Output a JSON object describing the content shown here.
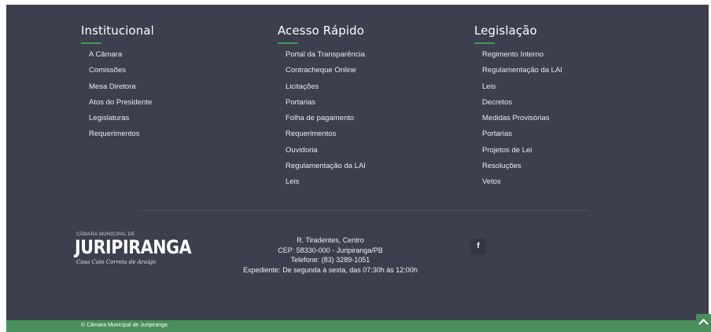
{
  "institucional": {
    "title": "Institucional",
    "items": [
      "A Câmara",
      "Comissões",
      "Mesa Diretora",
      "Atos do Presidente",
      "Legislaturas",
      "Requerimentos"
    ]
  },
  "acesso": {
    "title": "Acesso Rápido",
    "items": [
      "Portal da Transparência",
      "Contracheque Online",
      "Licitações",
      "Portarias",
      "Folha de pagamento",
      "Requerimentos",
      "Ouvidoria",
      "Regulamentação da LAI",
      "Leis"
    ]
  },
  "legislacao": {
    "title": "Legislação",
    "items": [
      "Regimento Interno",
      "Regulamentação da LAI",
      "Leis",
      "Decretos",
      "Medidas Provisórias",
      "Portarias",
      "Projetos de Lei",
      "Resoluções",
      "Vetos"
    ]
  },
  "logo": {
    "small": "CÂMARA MUNICIPAL DE",
    "big": "JURIPIRANGA",
    "script": "Casa Caio Correia de Araújo"
  },
  "address": {
    "street": "R. Tiradentes, Centro",
    "cep": "CEP: 58330-000 - Juripiranga/PB",
    "phone": "Telefone: (83) 3289-1051",
    "hours": "Expediente: De segunda à sexta, das 07:30h às 12:00h"
  },
  "social": {
    "facebook": "f"
  },
  "copyright": "© Câmara Municipal de Juripiranga",
  "colors": {
    "footer_bg": "#3b3f4e",
    "accent": "#3f9a52",
    "bottom_bar": "#4a8e59"
  },
  "icons": {
    "facebook": "facebook-icon",
    "back_to_top": "chevron-up-icon"
  }
}
